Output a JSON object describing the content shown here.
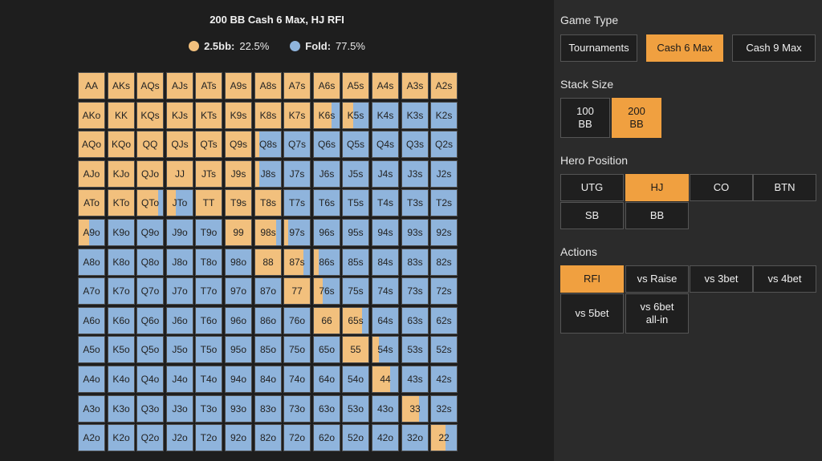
{
  "title": "200 BB Cash 6 Max, HJ RFI",
  "legend": [
    {
      "label": "2.5bb:",
      "value": "22.5%",
      "color": "#f2c07d"
    },
    {
      "label": "Fold:",
      "value": "77.5%",
      "color": "#8fb4dc"
    }
  ],
  "colors": {
    "raise": "#f2c07d",
    "fold": "#8fb4dc",
    "accent": "#f0a040"
  },
  "grid": {
    "labels": [
      [
        "AA",
        "AKs",
        "AQs",
        "AJs",
        "ATs",
        "A9s",
        "A8s",
        "A7s",
        "A6s",
        "A5s",
        "A4s",
        "A3s",
        "A2s"
      ],
      [
        "AKo",
        "KK",
        "KQs",
        "KJs",
        "KTs",
        "K9s",
        "K8s",
        "K7s",
        "K6s",
        "K5s",
        "K4s",
        "K3s",
        "K2s"
      ],
      [
        "AQo",
        "KQo",
        "QQ",
        "QJs",
        "QTs",
        "Q9s",
        "Q8s",
        "Q7s",
        "Q6s",
        "Q5s",
        "Q4s",
        "Q3s",
        "Q2s"
      ],
      [
        "AJo",
        "KJo",
        "QJo",
        "JJ",
        "JTs",
        "J9s",
        "J8s",
        "J7s",
        "J6s",
        "J5s",
        "J4s",
        "J3s",
        "J2s"
      ],
      [
        "ATo",
        "KTo",
        "QTo",
        "JTo",
        "TT",
        "T9s",
        "T8s",
        "T7s",
        "T6s",
        "T5s",
        "T4s",
        "T3s",
        "T2s"
      ],
      [
        "A9o",
        "K9o",
        "Q9o",
        "J9o",
        "T9o",
        "99",
        "98s",
        "97s",
        "96s",
        "95s",
        "94s",
        "93s",
        "92s"
      ],
      [
        "A8o",
        "K8o",
        "Q8o",
        "J8o",
        "T8o",
        "98o",
        "88",
        "87s",
        "86s",
        "85s",
        "84s",
        "83s",
        "82s"
      ],
      [
        "A7o",
        "K7o",
        "Q7o",
        "J7o",
        "T7o",
        "97o",
        "87o",
        "77",
        "76s",
        "75s",
        "74s",
        "73s",
        "72s"
      ],
      [
        "A6o",
        "K6o",
        "Q6o",
        "J6o",
        "T6o",
        "96o",
        "86o",
        "76o",
        "66",
        "65s",
        "64s",
        "63s",
        "62s"
      ],
      [
        "A5o",
        "K5o",
        "Q5o",
        "J5o",
        "T5o",
        "95o",
        "85o",
        "75o",
        "65o",
        "55",
        "54s",
        "53s",
        "52s"
      ],
      [
        "A4o",
        "K4o",
        "Q4o",
        "J4o",
        "T4o",
        "94o",
        "84o",
        "74o",
        "64o",
        "54o",
        "44",
        "43s",
        "42s"
      ],
      [
        "A3o",
        "K3o",
        "Q3o",
        "J3o",
        "T3o",
        "93o",
        "83o",
        "73o",
        "63o",
        "53o",
        "43o",
        "33",
        "32s"
      ],
      [
        "A2o",
        "K2o",
        "Q2o",
        "J2o",
        "T2o",
        "92o",
        "82o",
        "72o",
        "62o",
        "52o",
        "42o",
        "32o",
        "22"
      ]
    ],
    "raise_fraction": [
      [
        1,
        1,
        1,
        1,
        1,
        1,
        1,
        1,
        1,
        1,
        1,
        1,
        1
      ],
      [
        1,
        1,
        1,
        1,
        1,
        1,
        1,
        1,
        0.7,
        0.4,
        0,
        0,
        0
      ],
      [
        1,
        1,
        1,
        1,
        1,
        1,
        0.15,
        0,
        0,
        0,
        0,
        0,
        0
      ],
      [
        1,
        1,
        1,
        1,
        1,
        1,
        0.15,
        0,
        0,
        0,
        0,
        0,
        0
      ],
      [
        1,
        1,
        0.8,
        0.35,
        1,
        1,
        1,
        0,
        0,
        0,
        0,
        0,
        0
      ],
      [
        0.4,
        0,
        0,
        0,
        0,
        1,
        0.8,
        0.15,
        0,
        0,
        0,
        0,
        0
      ],
      [
        0,
        0,
        0,
        0,
        0,
        0,
        1,
        0.75,
        0.2,
        0,
        0,
        0,
        0
      ],
      [
        0,
        0,
        0,
        0,
        0,
        0,
        0,
        1,
        0.35,
        0,
        0,
        0,
        0
      ],
      [
        0,
        0,
        0,
        0,
        0,
        0,
        0,
        0,
        1,
        0.75,
        0,
        0,
        0
      ],
      [
        0,
        0,
        0,
        0,
        0,
        0,
        0,
        0,
        0,
        1,
        0.25,
        0,
        0
      ],
      [
        0,
        0,
        0,
        0,
        0,
        0,
        0,
        0,
        0,
        0,
        0.7,
        0,
        0
      ],
      [
        0,
        0,
        0,
        0,
        0,
        0,
        0,
        0,
        0,
        0,
        0,
        0.65,
        0
      ],
      [
        0,
        0,
        0,
        0,
        0,
        0,
        0,
        0,
        0,
        0,
        0,
        0,
        0.55
      ]
    ]
  },
  "sidebar": {
    "game_type": {
      "label": "Game Type",
      "options": [
        "Tournaments",
        "Cash 6 Max",
        "Cash 9 Max"
      ],
      "selected": "Cash 6 Max"
    },
    "stack_size": {
      "label": "Stack Size",
      "options": [
        {
          "line1": "100",
          "line2": "BB"
        },
        {
          "line1": "200",
          "line2": "BB"
        }
      ],
      "selected_index": 1
    },
    "hero_position": {
      "label": "Hero Position",
      "options": [
        "UTG",
        "HJ",
        "CO",
        "BTN",
        "SB",
        "BB"
      ],
      "selected": "HJ"
    },
    "actions": {
      "label": "Actions",
      "options": [
        {
          "line1": "RFI",
          "line2": ""
        },
        {
          "line1": "vs Raise",
          "line2": ""
        },
        {
          "line1": "vs 3bet",
          "line2": ""
        },
        {
          "line1": "vs 4bet",
          "line2": ""
        },
        {
          "line1": "vs 5bet",
          "line2": ""
        },
        {
          "line1": "vs 6bet",
          "line2": "all-in"
        }
      ],
      "selected_index": 0
    }
  }
}
